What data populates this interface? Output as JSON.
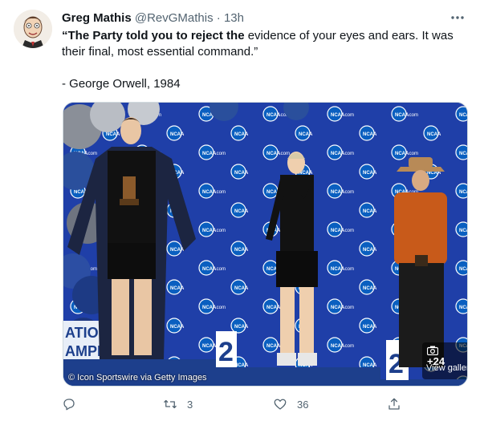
{
  "tweet": {
    "author_name": "Greg Mathis",
    "author_handle": "@RevGMathis",
    "separator": "·",
    "time": "13h",
    "more_label": "•••",
    "text_bold": "“The Party told you to reject the",
    "text_rest": " evidence of your eyes and ears. It was",
    "text_line2": "their final, most essential command.”",
    "attribution": "- George Orwell, 1984"
  },
  "media": {
    "backdrop_logo_text": "NCAA.com",
    "banner_line1": "ATIONAL",
    "banner_line2": "AMPION",
    "podium_numbers": [
      "2",
      "2"
    ],
    "credit": "© Icon Sportswire via Getty Images",
    "gallery_count": "+24",
    "gallery_label": "View gallery",
    "colors": {
      "backdrop": "#1f3fa8",
      "logo_circle": "#0a5fc0",
      "podium": "#1d3f8c",
      "texas_orange": "#c85a1a"
    }
  },
  "actions": {
    "reply_count": "",
    "retweet_count": "3",
    "like_count": "36",
    "share_count": ""
  },
  "icons": [
    "avatar",
    "more-icon",
    "reply-icon",
    "retweet-icon",
    "like-icon",
    "share-icon",
    "camera-icon"
  ]
}
